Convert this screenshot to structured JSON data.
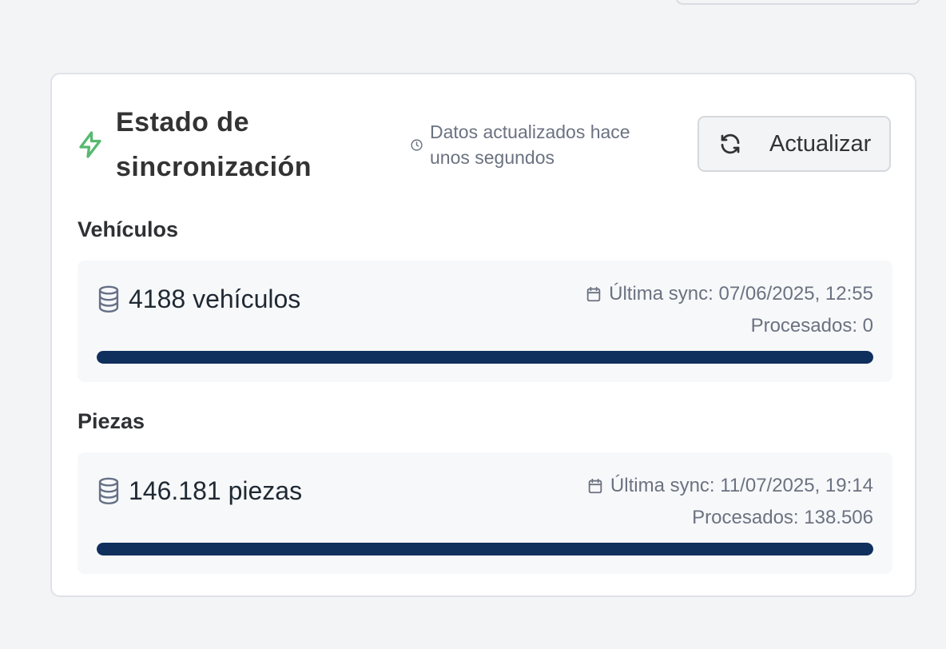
{
  "header": {
    "title": "Estado de sincronización",
    "updated_text": "Datos actualizados hace unos segundos",
    "refresh_label": "Actualizar"
  },
  "sections": [
    {
      "label": "Vehículos",
      "count": "4188 vehículos",
      "last_sync": "Última sync: 07/06/2025, 12:55",
      "processed": "Procesados: 0",
      "progress_percent": 100
    },
    {
      "label": "Piezas",
      "count": "146.181 piezas",
      "last_sync": "Última sync: 11/07/2025, 19:14",
      "processed": "Procesados: 138.506",
      "progress_percent": 100
    }
  ],
  "icons": {
    "bolt": "bolt-icon",
    "clock": "clock-icon",
    "refresh": "refresh-icon",
    "database": "database-icon",
    "calendar": "calendar-icon"
  },
  "colors": {
    "accent_green": "#57b96f",
    "progress_fill": "#0f2f5d",
    "card_background": "#ffffff",
    "page_background": "#f3f4f6"
  }
}
